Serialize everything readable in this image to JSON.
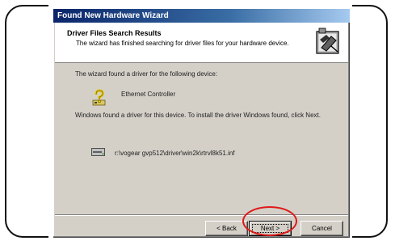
{
  "window": {
    "title": "Found New Hardware Wizard"
  },
  "header": {
    "title": "Driver Files Search Results",
    "subtitle": "The wizard has finished searching for driver files for your hardware device.",
    "icon": "hardware-wizard-icon"
  },
  "content": {
    "found_text": "The wizard found a driver for the following device:",
    "device_name": "Ethernet Controller",
    "device_icon": "unknown-device-icon",
    "install_text": "Windows found a driver for this device. To install the driver Windows found, click Next.",
    "driver_path": "r:\\vogear gvp512\\driver\\win2k\\rtrvl8k51.inf",
    "file_icon": "drive-icon"
  },
  "buttons": {
    "back_label": "< Back",
    "next_label": "Next >",
    "cancel_label": "Cancel"
  },
  "colors": {
    "title_bar": "#0a246a",
    "dialog_bg": "#d4d0c8",
    "highlight": "#e01818"
  }
}
